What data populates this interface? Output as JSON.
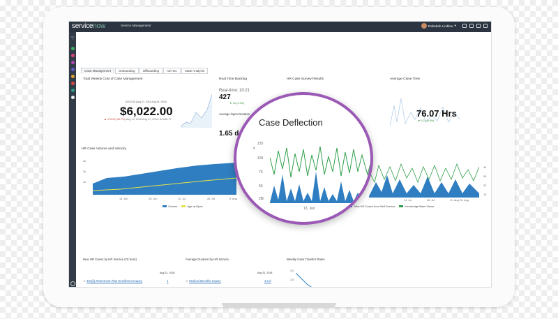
{
  "topbar": {
    "logo_service": "service",
    "logo_now": "now",
    "title": "Service Management",
    "user_name": "Rebekah Lindline"
  },
  "tabs": [
    "Case Management",
    "Onboarding",
    "Offboarding",
    "Ad Hoc",
    "State Analysis"
  ],
  "panels": {
    "cost": {
      "title": "Total Weekly Cost of Case Management",
      "date_range": "JOB 2018 (Aug 21, 2018-Aug 28, 2018)",
      "value": "$6,022.00",
      "change": "▲ 170.00 (34.7%)",
      "prev": "Aug 14, 2018 Aug 21, 2018: $4,848.72"
    },
    "backlog": {
      "title": "Real Time Backlog",
      "realtime": "Real-time: 10:21",
      "value": "427",
      "change": "▼ 10 (4.3%)",
      "avg_label": "Average Open Duration",
      "avg_value": "1.65 d"
    },
    "survey": {
      "title": "HR Case Survey Results"
    },
    "close": {
      "title": "Average Close Time",
      "value": "76.07 Hrs",
      "change": "▼ 5.21 (6.4%)"
    }
  },
  "volume_chart": {
    "title": "HR Case Volume and Velocity",
    "yticks": [
      "4k",
      "2k",
      "1k",
      "500"
    ],
    "xticks": [
      "14. Jun",
      "28. Jun",
      "12. Jul",
      "26. Jul",
      "9. Aug"
    ],
    "legend": [
      "Volume",
      "Age at Open"
    ]
  },
  "deflection_chart": {
    "title": "Case Deflection",
    "yticks": [
      "125",
      "100",
      "75",
      "50",
      "25",
      "0"
    ],
    "yaxis_label": "#",
    "xtick": "13. Jun",
    "right_xticks": [
      "14. Jul",
      "28. Jul",
      "11. Aug",
      "25. Aug"
    ],
    "right_yticks": [
      "40",
      "30",
      "20",
      "10"
    ],
    "legend": [
      "Total HR Cases from Self Service",
      "Knowledge Base Views"
    ]
  },
  "bottom": {
    "col1": {
      "title": "New HR Cases by HR Service (7d Sum)",
      "date": "Aug 31, 2018",
      "item": "401(k) Retirement Plan Enrollment Inquiry",
      "value": "1"
    },
    "col2": {
      "title": "Average Duration by HR Service",
      "date": "Aug 31, 2018",
      "item": "Medical Benefits Inquiry",
      "value": "4.0 d"
    },
    "col3": {
      "title": "Weekly Case Transfer Rates",
      "y1": "3.0",
      "y2": "2.5"
    }
  },
  "colors": {
    "blue": "#2f7ec1",
    "green": "#2e9e48",
    "purple": "#9b59b6",
    "yellow": "#e6e24a"
  },
  "icons": [
    "filter-icon",
    "home-icon",
    "heart-icon",
    "list-icon",
    "star-icon",
    "people-icon",
    "check-icon",
    "info-icon",
    "settings-icon"
  ]
}
